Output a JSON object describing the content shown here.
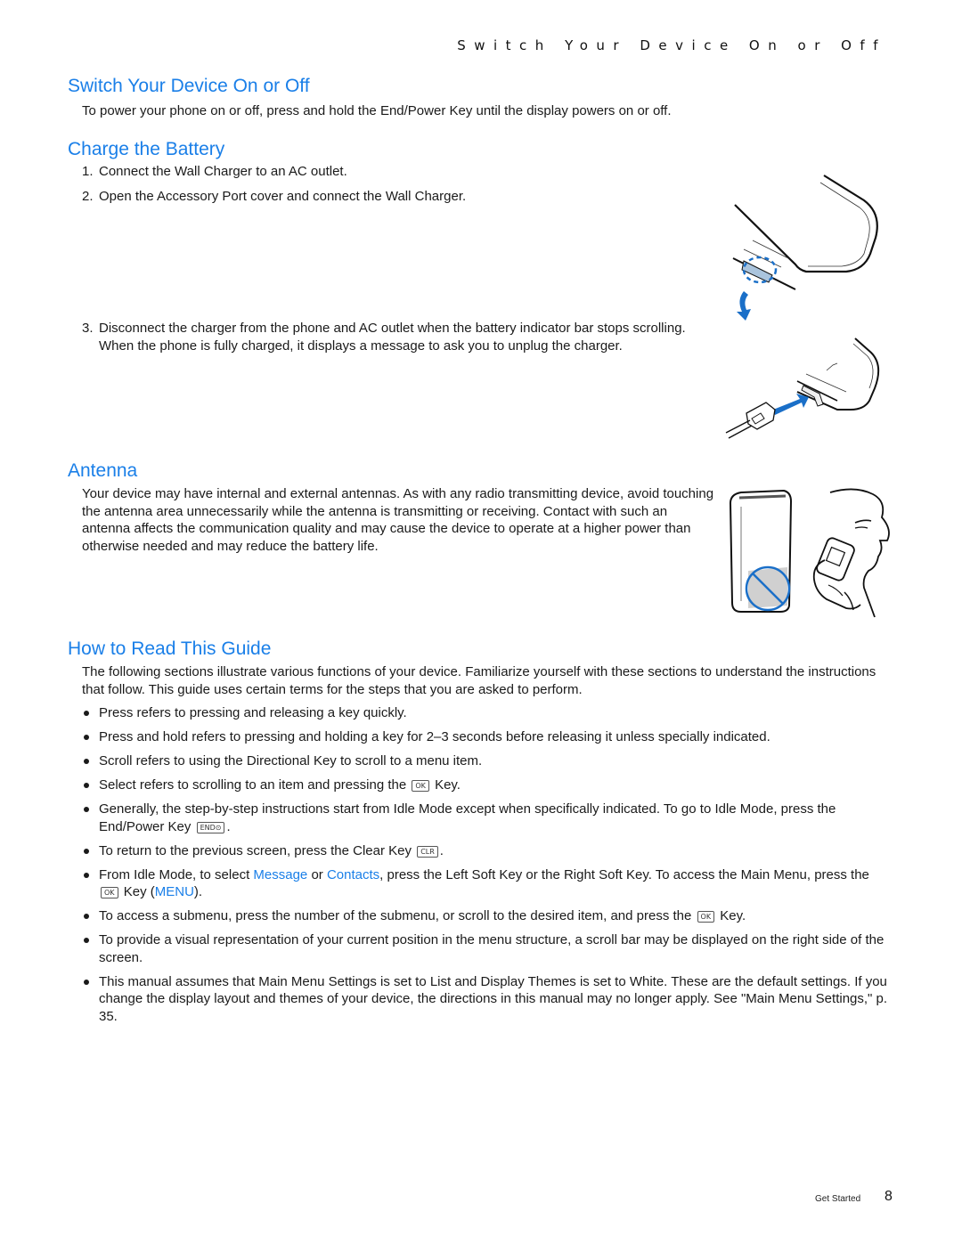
{
  "running_head": "Switch Your Device On or Off",
  "sections": {
    "switch": {
      "title": "Switch Your Device On or Off",
      "body": "To power your phone on or off, press and hold the End/Power Key until the display powers on or off."
    },
    "charge": {
      "title": "Charge the Battery",
      "steps": [
        {
          "num": "1.",
          "text": "Connect the Wall Charger to an AC outlet."
        },
        {
          "num": "2.",
          "text": "Open the Accessory Port cover and connect the Wall Charger."
        },
        {
          "num": "3.",
          "text": "Disconnect the charger from the phone and AC outlet when the battery indicator bar stops scrolling. When the phone is fully charged, it displays a message to ask you to unplug the charger."
        }
      ]
    },
    "antenna": {
      "title": "Antenna",
      "body": "Your device may have internal and external antennas. As with any radio transmitting device, avoid touching the antenna area unnecessarily while the antenna is transmitting or receiving. Contact with such an antenna affects the communication quality and may cause the device to operate at a higher power than otherwise needed and may reduce the battery life."
    },
    "guide": {
      "title": "How to Read This Guide",
      "intro": "The following sections illustrate various functions of your device. Familiarize yourself with these sections to understand the instructions that follow. This guide uses certain terms for the steps that you are asked to perform.",
      "bullets": {
        "b1": "Press refers to pressing and releasing a key quickly.",
        "b2": "Press and hold refers to pressing and holding a key for 2–3 seconds before releasing it unless specially indicated.",
        "b3": "Scroll refers to using the Directional Key to scroll to a menu item.",
        "b4_pre": "Select refers to scrolling to an item and pressing the",
        "b4_post": "Key.",
        "b5_pre": "Generally, the step-by-step instructions start from Idle Mode except when specifically indicated. To go to Idle Mode, press the End/Power Key",
        "b5_post": ".",
        "b6_pre": "To return to the previous screen, press the Clear Key",
        "b6_post": ".",
        "b7_a": "From Idle Mode, to select",
        "b7_link1": "Message",
        "b7_b": "or",
        "b7_link2": "Contacts",
        "b7_c": ", press the Left Soft Key or the Right Soft Key. To access the Main Menu, press the",
        "b7_d": "Key (",
        "b7_link3": "MENU",
        "b7_e": ").",
        "b8_pre": "To access a submenu, press the number of the submenu, or scroll to the desired item, and press the",
        "b8_post": "Key.",
        "b9": "To provide a visual representation of your current position in the menu structure, a scroll bar may be displayed on the right side of the screen.",
        "b10": "This manual assumes that Main Menu Settings is set to List and Display Themes is set to White. These are the default settings. If you change the display layout and themes of your device, the directions in this manual may no longer apply. See \"Main Menu Settings,\" p. 35."
      }
    }
  },
  "keys": {
    "ok": "OK",
    "end": "END⊙",
    "clr": "CLR"
  },
  "footer": {
    "section_label": "Get Started",
    "page_number": "8"
  },
  "colors": {
    "heading": "#1a7fe8",
    "link": "#1a7fe8",
    "illustration_accent": "#1a6fc8"
  }
}
